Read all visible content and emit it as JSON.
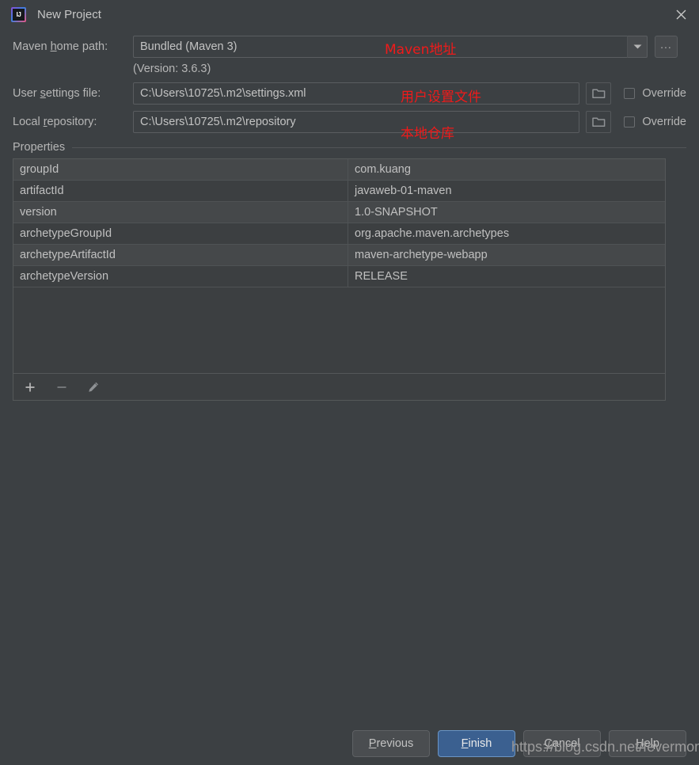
{
  "window": {
    "title": "New Project",
    "logo_text": "IJ",
    "close_icon": "close-icon"
  },
  "form": {
    "maven_home": {
      "label_pre": "Maven ",
      "label_mnemonic": "h",
      "label_post": "ome path:",
      "value": "Bundled (Maven 3)",
      "dropdown_icon": "chevron-down-icon",
      "browse_label": "...",
      "version_note": "(Version: 3.6.3)",
      "annotation": "Maven地址"
    },
    "user_settings": {
      "label_pre": "User ",
      "label_mnemonic": "s",
      "label_post": "ettings file:",
      "value": "C:\\Users\\10725\\.m2\\settings.xml",
      "folder_icon": "folder-icon",
      "override_label": "Override",
      "override_checked": false,
      "annotation": "用户设置文件"
    },
    "local_repository": {
      "label_pre": "Local ",
      "label_mnemonic": "r",
      "label_post": "epository:",
      "value": "C:\\Users\\10725\\.m2\\repository",
      "folder_icon": "folder-icon",
      "override_label": "Override",
      "override_checked": false,
      "annotation": "本地仓库"
    }
  },
  "properties": {
    "title": "Properties",
    "rows": [
      {
        "key": "groupId",
        "value": "com.kuang"
      },
      {
        "key": "artifactId",
        "value": "javaweb-01-maven"
      },
      {
        "key": "version",
        "value": "1.0-SNAPSHOT"
      },
      {
        "key": "archetypeGroupId",
        "value": "org.apache.maven.archetypes"
      },
      {
        "key": "archetypeArtifactId",
        "value": "maven-archetype-webapp"
      },
      {
        "key": "archetypeVersion",
        "value": "RELEASE"
      }
    ],
    "toolbar": {
      "add_icon": "plus-icon",
      "remove_icon": "minus-icon",
      "edit_icon": "pencil-icon"
    }
  },
  "footer": {
    "previous": {
      "pre": "",
      "mnemonic": "P",
      "post": "revious"
    },
    "finish": {
      "pre": "",
      "mnemonic": "F",
      "post": "inish"
    },
    "cancel": {
      "pre": "",
      "mnemonic": "C",
      "post": "ancel"
    },
    "help": {
      "pre": "",
      "mnemonic": "H",
      "post": "elp"
    }
  },
  "watermark": "https://blog.csdn.net/fevermomo",
  "colors": {
    "background": "#3c4043",
    "accent": "#3b6090",
    "annotation": "#f01a1a",
    "border": "#5a5d60"
  }
}
